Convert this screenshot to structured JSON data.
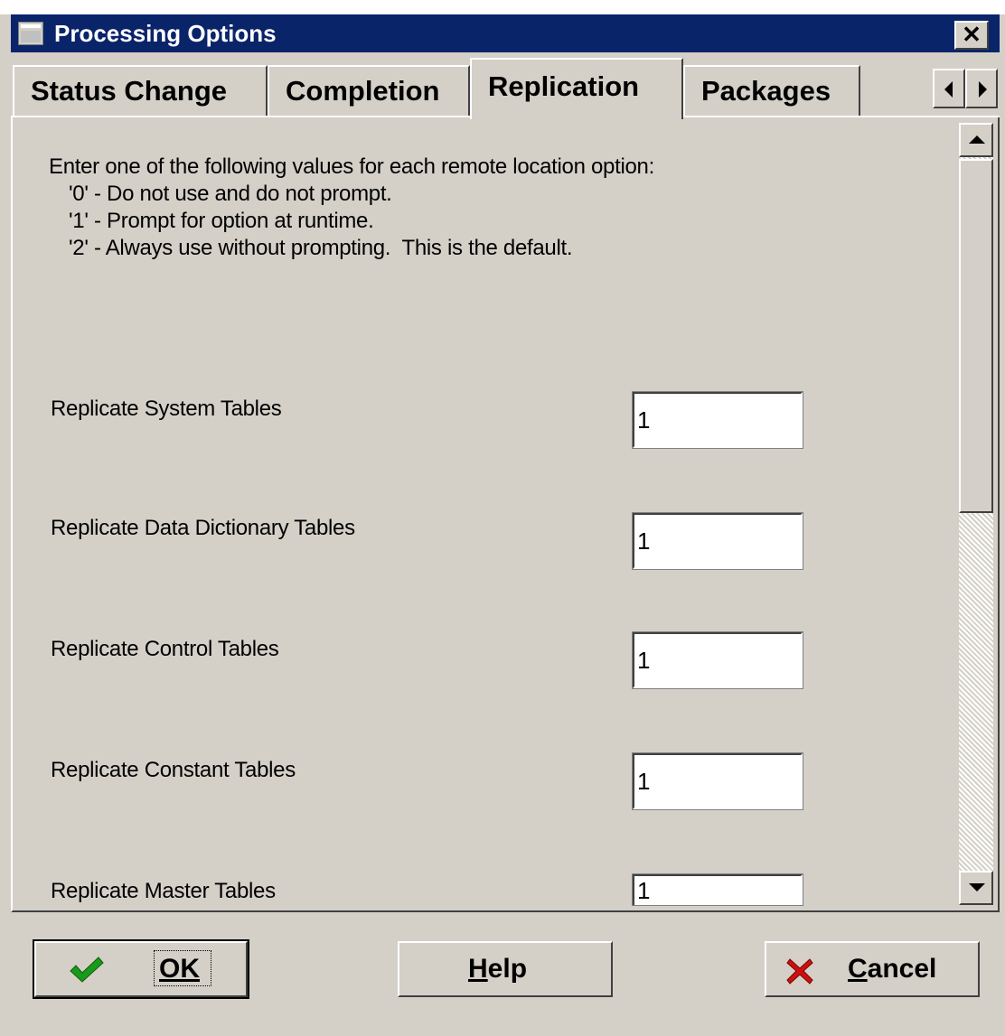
{
  "window": {
    "title": "Processing Options",
    "close_glyph": "✕"
  },
  "tabs": [
    {
      "label": "Status Change",
      "active": false
    },
    {
      "label": "Completion",
      "active": false
    },
    {
      "label": "Replication",
      "active": true
    },
    {
      "label": "Packages",
      "active": false
    }
  ],
  "instructions": {
    "line1": "Enter one of the following values for each remote location option:",
    "line2": "'0' - Do not use and do not prompt.",
    "line3": "'1' - Prompt for option at runtime.",
    "line4": "'2' - Always use without prompting.  This is the default."
  },
  "fields": [
    {
      "label": "Replicate System Tables",
      "value": "1"
    },
    {
      "label": "Replicate Data Dictionary Tables",
      "value": "1"
    },
    {
      "label": "Replicate Control Tables",
      "value": "1"
    },
    {
      "label": "Replicate Constant Tables",
      "value": "1"
    },
    {
      "label": "Replicate Master Tables",
      "value": "1"
    }
  ],
  "buttons": {
    "ok": {
      "label": "OK",
      "mnemonic": "O"
    },
    "help": {
      "label": "Help",
      "mnemonic": "H"
    },
    "cancel": {
      "label": "Cancel",
      "mnemonic": "C"
    }
  },
  "icons": {
    "ok": "checkmark-icon",
    "cancel": "red-x-icon",
    "app": "window-app-icon"
  },
  "colors": {
    "titlebar": "#0a246a",
    "face": "#d4d0c8",
    "check_green": "#1a9a1a",
    "cancel_red": "#cc1010"
  }
}
